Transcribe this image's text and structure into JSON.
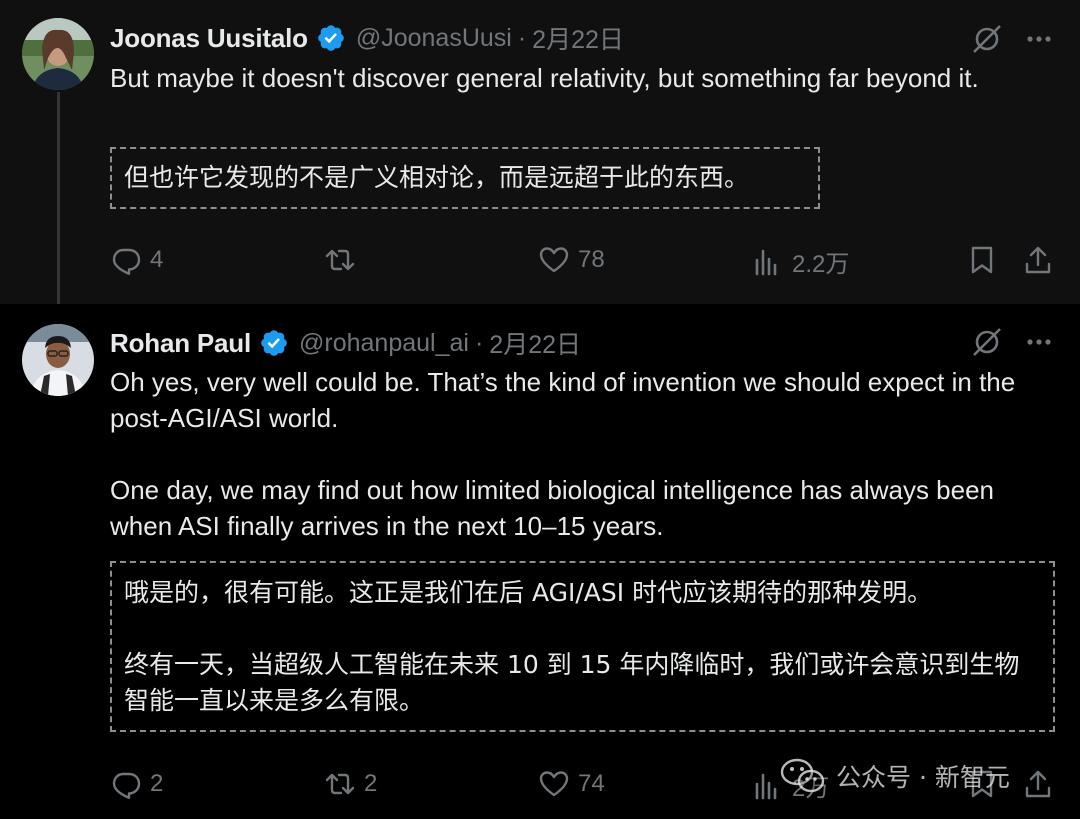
{
  "tweets": [
    {
      "author_name": "Joonas Uusitalo",
      "handle": "@JoonasUusi",
      "separator": "·",
      "date": "2月22日",
      "text": "But maybe it doesn't discover general relativity, but something far beyond it.",
      "translation": "但也许它发现的不是广义相对论，而是远超于此的东西。",
      "replies": "4",
      "retweets": "",
      "likes": "78",
      "views": "2.2万"
    },
    {
      "author_name": "Rohan Paul",
      "handle": "@rohanpaul_ai",
      "separator": "·",
      "date": "2月22日",
      "text_p1": "Oh yes, very well could be. That’s the kind of invention we should expect in the post-AGI/ASI world.",
      "text_p2": "One day, we may find out how limited biological intelligence has always been when ASI finally arrives in the next 10–15 years.",
      "translation_p1": "哦是的，很有可能。这正是我们在后 AGI/ASI 时代应该期待的那种发明。",
      "translation_p2": "终有一天，当超级人工智能在未来 10 到 15 年内降临时，我们或许会意识到生物智能一直以来是多么有限。",
      "replies": "2",
      "retweets": "2",
      "likes": "74",
      "views": "2万"
    }
  ],
  "watermark": {
    "text": "公众号 · 新智元",
    "icon": "wechat-icon"
  },
  "icons": {
    "reply": "reply-icon",
    "retweet": "retweet-icon",
    "like": "heart-icon",
    "views": "views-icon",
    "bookmark": "bookmark-icon",
    "share": "share-icon",
    "grok": "grok-icon",
    "more": "more-icon",
    "verified": "verified-badge-icon"
  },
  "colors": {
    "background": "#000000",
    "first_tweet_background": "#101010",
    "text": "#e7e9ea",
    "secondary_text": "#71767b",
    "verified": "#1d9bf0"
  }
}
